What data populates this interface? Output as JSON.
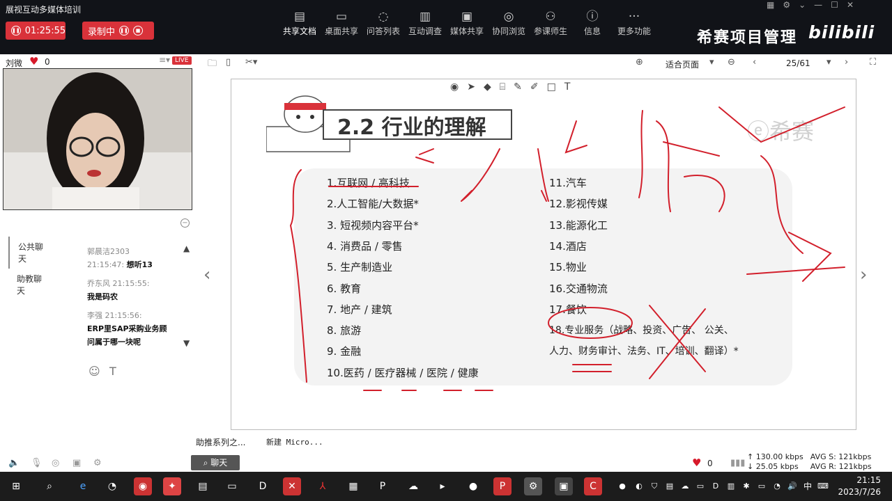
{
  "app": {
    "title": "展视互动多媒体培训",
    "brand": "希赛项目管理",
    "bili": "bilibili"
  },
  "recording": {
    "timer": "01:25:55",
    "status": "录制中"
  },
  "toolbar": {
    "items": [
      {
        "label": "共享文档",
        "icon": "document-icon"
      },
      {
        "label": "桌面共享",
        "icon": "desktop-share-icon"
      },
      {
        "label": "问答列表",
        "icon": "qa-icon"
      },
      {
        "label": "互动调查",
        "icon": "poll-icon"
      },
      {
        "label": "媒体共享",
        "icon": "media-icon"
      },
      {
        "label": "协同浏览",
        "icon": "browse-icon"
      },
      {
        "label": "参课师生",
        "icon": "people-icon"
      },
      {
        "label": "信息",
        "icon": "info-icon"
      },
      {
        "label": "更多功能",
        "icon": "more-icon"
      }
    ]
  },
  "presenter": {
    "name": "刘微",
    "likes": "0",
    "live_badge": "LIVE"
  },
  "chat": {
    "tabs": [
      "公共聊天",
      "助教聊天"
    ],
    "messages": [
      {
        "meta": "郭晨洁2303",
        "time": "21:15:47:",
        "text": "想听13"
      },
      {
        "meta": "乔东风 21:15:55:",
        "text": "我是码农"
      },
      {
        "meta": "李强 21:15:56:",
        "text": "ERP里SAP采购业务顾问属于哪一块呢"
      }
    ]
  },
  "doc": {
    "zoom": "适合页面",
    "page": "25/61"
  },
  "slide": {
    "title": "2.2 行业的理解",
    "watermark": "ⓔ希赛",
    "left_items": [
      "1.互联网 / 高科技",
      "2.人工智能/大数据*",
      "3. 短视频内容平台*",
      "4. 消费品 / 零售",
      "5. 生产制造业",
      "6. 教育",
      "7. 地产 / 建筑",
      "8. 旅游",
      "9. 金融",
      "10.医药 / 医疗器械 / 医院 / 健康"
    ],
    "right_items": [
      "11.汽车",
      "12.影视传媒",
      "13.能源化工",
      "14.酒店",
      "15.物业",
      "16.交通物流",
      "17.餐饮",
      "18.专业服务（战略、投资、广告、 公关、",
      "人力、财务审计、法务、IT、培训、翻译）*"
    ]
  },
  "bottom": {
    "tabs": [
      "助推系列之...",
      "新建 Micro..."
    ],
    "chat_button": "聊天",
    "likes": "0",
    "stats": {
      "up": "130.00 kbps",
      "down": "25.05 kbps",
      "avg_s": "AVG S: 121kbps",
      "avg_r": "AVG R: 121kbps"
    }
  },
  "taskbar": {
    "time": "21:15",
    "date": "2023/7/26",
    "ime": "中"
  }
}
